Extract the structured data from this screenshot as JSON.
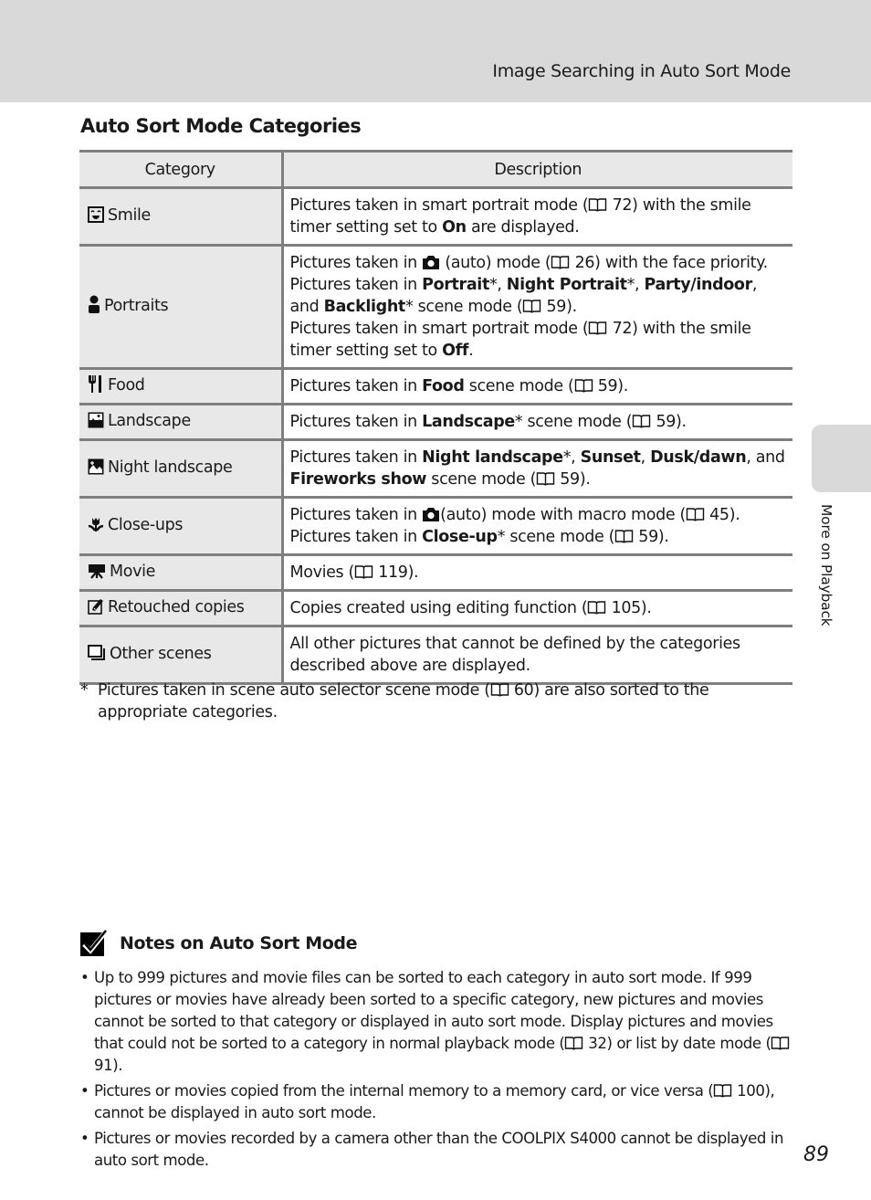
{
  "header": {
    "title": "Image Searching in Auto Sort Mode"
  },
  "section": {
    "title": "Auto Sort Mode Categories"
  },
  "table": {
    "columns": [
      "Category",
      "Description"
    ],
    "rows": [
      {
        "icon": "smile-icon",
        "category": "Smile",
        "description": [
          [
            {
              "t": "Pictures taken in smart portrait mode ("
            },
            {
              "book": true
            },
            {
              "t": " 72) with the smile timer setting set to "
            },
            {
              "b": "On"
            },
            {
              "t": " are displayed."
            }
          ]
        ]
      },
      {
        "icon": "portrait-icon",
        "category": "Portraits",
        "description": [
          [
            {
              "t": "Pictures taken in "
            },
            {
              "cam": true
            },
            {
              "t": " (auto) mode ("
            },
            {
              "book": true
            },
            {
              "t": " 26) with the face priority."
            }
          ],
          [
            {
              "t": "Pictures taken in "
            },
            {
              "b": "Portrait"
            },
            {
              "t": "*, "
            },
            {
              "b": "Night Portrait"
            },
            {
              "t": "*, "
            },
            {
              "b": "Party/indoor"
            },
            {
              "t": ", and "
            },
            {
              "b": "Backlight"
            },
            {
              "t": "* scene mode ("
            },
            {
              "book": true
            },
            {
              "t": " 59)."
            }
          ],
          [
            {
              "t": "Pictures taken in smart portrait mode ("
            },
            {
              "book": true
            },
            {
              "t": " 72) with the smile timer setting set to "
            },
            {
              "b": "Off"
            },
            {
              "t": "."
            }
          ]
        ]
      },
      {
        "icon": "food-icon",
        "category": "Food",
        "description": [
          [
            {
              "t": "Pictures taken in "
            },
            {
              "b": "Food"
            },
            {
              "t": " scene mode ("
            },
            {
              "book": true
            },
            {
              "t": " 59)."
            }
          ]
        ]
      },
      {
        "icon": "landscape-icon",
        "category": "Landscape",
        "description": [
          [
            {
              "t": "Pictures taken in "
            },
            {
              "b": "Landscape"
            },
            {
              "t": "* scene mode ("
            },
            {
              "book": true
            },
            {
              "t": " 59)."
            }
          ]
        ]
      },
      {
        "icon": "night-landscape-icon",
        "category": "Night landscape",
        "description": [
          [
            {
              "t": "Pictures taken in "
            },
            {
              "b": "Night landscape"
            },
            {
              "t": "*, "
            },
            {
              "b": "Sunset"
            },
            {
              "t": ", "
            },
            {
              "b": "Dusk/dawn"
            },
            {
              "t": ", and "
            },
            {
              "b": "Fireworks show"
            },
            {
              "t": " scene mode ("
            },
            {
              "book": true
            },
            {
              "t": " 59)."
            }
          ]
        ]
      },
      {
        "icon": "close-up-icon",
        "category": "Close-ups",
        "description": [
          [
            {
              "t": "Pictures taken in "
            },
            {
              "cam": true
            },
            {
              "t": "(auto) mode with macro mode ("
            },
            {
              "book": true
            },
            {
              "t": " 45)."
            }
          ],
          [
            {
              "t": "Pictures taken in "
            },
            {
              "b": "Close-up"
            },
            {
              "t": "* scene mode ("
            },
            {
              "book": true
            },
            {
              "t": " 59)."
            }
          ]
        ]
      },
      {
        "icon": "movie-icon",
        "category": "Movie",
        "description": [
          [
            {
              "t": "Movies ("
            },
            {
              "book": true
            },
            {
              "t": " 119)."
            }
          ]
        ]
      },
      {
        "icon": "retouch-icon",
        "category": "Retouched copies",
        "description": [
          [
            {
              "t": "Copies created using editing function ("
            },
            {
              "book": true
            },
            {
              "t": " 105)."
            }
          ]
        ]
      },
      {
        "icon": "other-scenes-icon",
        "category": "Other scenes",
        "description": [
          [
            {
              "t": "All other pictures that cannot be defined by the categories described above are displayed."
            }
          ]
        ]
      }
    ]
  },
  "footnote": {
    "marker": "*",
    "parts": [
      {
        "t": "Pictures taken in scene auto selector scene mode ("
      },
      {
        "book": true
      },
      {
        "t": " 60) are also sorted to the appropriate categories."
      }
    ]
  },
  "notes": {
    "title": "Notes on Auto Sort Mode",
    "items": [
      [
        {
          "t": "Up to 999 pictures and movie files can be sorted to each category in auto sort mode. If 999 pictures or movies have already been sorted to a specific category, new pictures and movies cannot be sorted to that category or displayed in auto sort mode. Display pictures and movies that could not be sorted to a category in normal playback mode ("
        },
        {
          "book": true
        },
        {
          "t": " 32) or list by date mode ("
        },
        {
          "book": true
        },
        {
          "t": " 91)."
        }
      ],
      [
        {
          "t": "Pictures or movies copied from the internal memory to a memory card, or vice versa ("
        },
        {
          "book": true
        },
        {
          "t": " 100), cannot be displayed in auto sort mode."
        }
      ],
      [
        {
          "t": "Pictures or movies recorded by a camera other than the COOLPIX S4000 cannot be displayed in auto sort mode."
        }
      ]
    ]
  },
  "side_tab": {
    "label": "More on Playback"
  },
  "page_number": "89"
}
